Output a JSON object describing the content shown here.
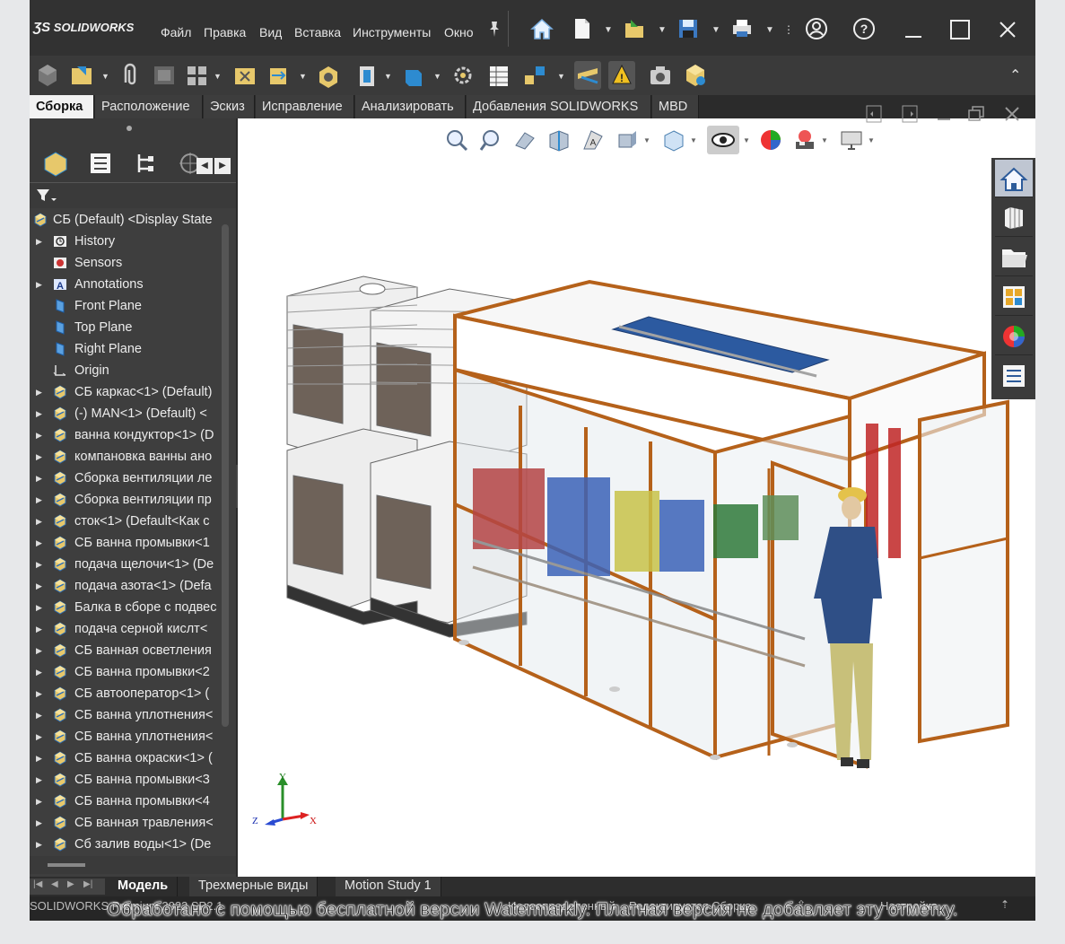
{
  "app": {
    "logo": "SOLIDWORKS",
    "menus": [
      "Файл",
      "Правка",
      "Вид",
      "Вставка",
      "Инструменты",
      "Окно"
    ]
  },
  "tabs": [
    "Сборка",
    "Расположение",
    "Эскиз",
    "Исправление",
    "Анализировать",
    "Добавления SOLIDWORKS",
    "MBD"
  ],
  "active_tab": "Сборка",
  "tree": {
    "root": "СБ (Default) <Display State",
    "items": [
      {
        "label": "History",
        "icon": "history-icon",
        "expand": true
      },
      {
        "label": "Sensors",
        "icon": "sensor-icon",
        "expand": false
      },
      {
        "label": "Annotations",
        "icon": "annotation-icon",
        "expand": true
      },
      {
        "label": "Front Plane",
        "icon": "plane-icon",
        "expand": false
      },
      {
        "label": "Top Plane",
        "icon": "plane-icon",
        "expand": false
      },
      {
        "label": "Right Plane",
        "icon": "plane-icon",
        "expand": false
      },
      {
        "label": "Origin",
        "icon": "origin-icon",
        "expand": false
      },
      {
        "label": "СБ каркас<1> (Default)",
        "icon": "assembly-icon",
        "expand": true
      },
      {
        "label": "(-) MAN<1> (Default) <",
        "icon": "assembly-icon",
        "expand": true
      },
      {
        "label": "ванна кондуктор<1> (D",
        "icon": "assembly-icon",
        "expand": true
      },
      {
        "label": "компановка ванны ано",
        "icon": "assembly-icon",
        "expand": true
      },
      {
        "label": "Сборка вентиляции ле",
        "icon": "assembly-icon",
        "expand": true
      },
      {
        "label": "Сборка вентиляции пр",
        "icon": "assembly-icon",
        "expand": true
      },
      {
        "label": "сток<1> (Default<Как с",
        "icon": "assembly-icon",
        "expand": true
      },
      {
        "label": "СБ ванна промывки<1",
        "icon": "assembly-icon",
        "expand": true
      },
      {
        "label": "подача щелочи<1> (De",
        "icon": "assembly-icon",
        "expand": true
      },
      {
        "label": "подача азота<1> (Defa",
        "icon": "assembly-icon",
        "expand": true
      },
      {
        "label": "Балка в сборе с подвес",
        "icon": "assembly-icon",
        "expand": true
      },
      {
        "label": "подача серной кислт<",
        "icon": "assembly-icon",
        "expand": true
      },
      {
        "label": "СБ ванная осветления",
        "icon": "assembly-icon",
        "expand": true
      },
      {
        "label": "СБ ванна промывки<2",
        "icon": "assembly-icon",
        "expand": true
      },
      {
        "label": "СБ автооператор<1> (",
        "icon": "assembly-icon",
        "expand": true
      },
      {
        "label": "СБ ванна уплотнения<",
        "icon": "assembly-icon",
        "expand": true
      },
      {
        "label": "СБ ванна уплотнения<",
        "icon": "assembly-icon",
        "expand": true
      },
      {
        "label": "СБ ванна окраски<1> (",
        "icon": "assembly-icon",
        "expand": true
      },
      {
        "label": "СБ ванна промывки<3",
        "icon": "assembly-icon",
        "expand": true
      },
      {
        "label": "СБ ванна промывки<4",
        "icon": "assembly-icon",
        "expand": true
      },
      {
        "label": "СБ ванная травления<",
        "icon": "assembly-icon",
        "expand": true
      },
      {
        "label": "Сб залив воды<1> (De",
        "icon": "assembly-icon",
        "expand": true
      }
    ]
  },
  "bottom_tabs": [
    "Модель",
    "Трехмерные виды",
    "Motion Study 1"
  ],
  "active_bottom_tab": "Модель",
  "status": {
    "left": "SOLIDWORKS Premium 2022 SP2.1",
    "mid1": "Недоопределенный",
    "mid2": "Редактируется Сборка",
    "right": "Настройка"
  },
  "triad": {
    "x": "X",
    "y": "Y",
    "z": "Z"
  },
  "watermark": "Обработано с помощью бесплатной версии Watermarkly. Платная версия не добавляет эту отметку.",
  "colors": {
    "frame_orange": "#b5611a",
    "glass": "#dfe6ec",
    "toolbar_bg": "#3a3a3a",
    "tree_bg": "#3e3e3e"
  }
}
